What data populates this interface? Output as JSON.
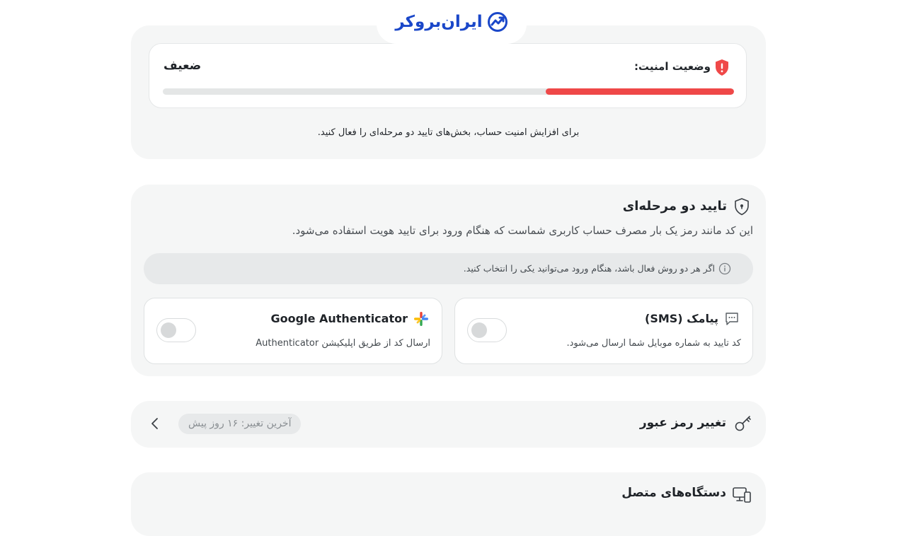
{
  "logo": {
    "text": "ایران‌بروکر",
    "brand_color": "#1a47c9"
  },
  "security_status": {
    "label": "وضعیت امنیت:",
    "level": "ضعیف",
    "progress_fraction": 0.33,
    "bar_color": "#ef4848",
    "hint": "برای افزایش امنیت حساب، بخش‌های تایید دو مرحله‌ای را فعال کنید."
  },
  "two_factor": {
    "title": "تایید دو مرحله‌ای",
    "description": "این کد مانند رمز یک بار مصرف حساب کاربری شماست که هنگام ورود برای تایید هویت استفاده می‌شود.",
    "info": "اگر هر دو روش فعال باشد، هنگام ورود می‌توانید یکی را انتخاب کنید.",
    "methods": [
      {
        "title": "پیامک (SMS)",
        "description": "کد تایید به شماره موبایل شما ارسال می‌شود.",
        "enabled": false,
        "icon": "message-icon"
      },
      {
        "title": "Google Authenticator",
        "description": "ارسال کد از طریق اپلیکیشن Authenticator",
        "enabled": false,
        "icon": "google-authenticator-icon"
      }
    ]
  },
  "password": {
    "title": "تغییر رمز عبور",
    "last_change": "آخرین تغییر: ۱۶ روز پیش"
  },
  "devices": {
    "title": "دستگاه‌های متصل"
  }
}
